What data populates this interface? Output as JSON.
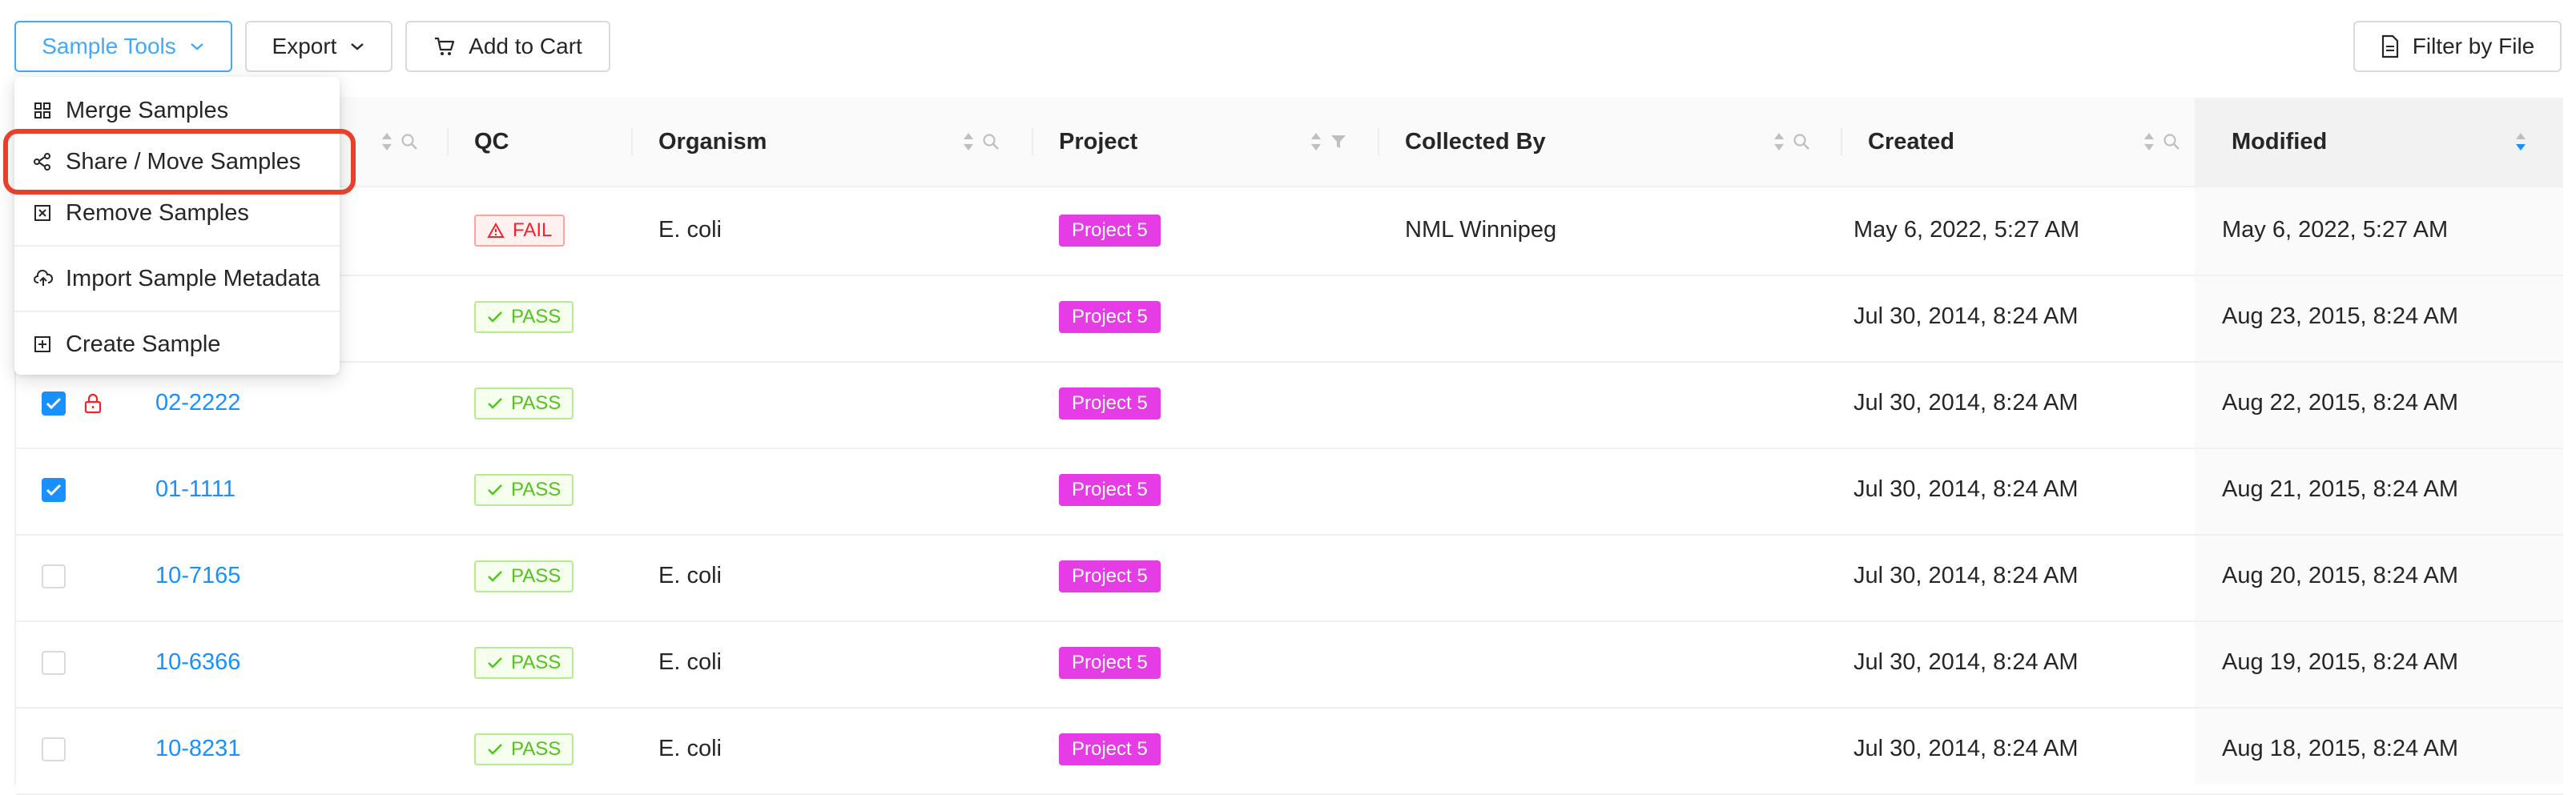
{
  "toolbar": {
    "sample_tools_label": "Sample Tools",
    "export_label": "Export",
    "add_to_cart_label": "Add to Cart",
    "filter_by_file_label": "Filter by File"
  },
  "table": {
    "columns": {
      "qc": "QC",
      "organism": "Organism",
      "project": "Project",
      "collected_by": "Collected By",
      "created": "Created",
      "modified": "Modified"
    },
    "sort": {
      "column": "Modified",
      "direction": "descending"
    },
    "rows": [
      {
        "selected": false,
        "locked": false,
        "name": "",
        "qc": "FAIL",
        "organism": "E. coli",
        "project": "Project 5",
        "collected_by": "NML Winnipeg",
        "created": "May 6, 2022, 5:27 AM",
        "modified": "May 6, 2022, 5:27 AM"
      },
      {
        "selected": false,
        "locked": false,
        "name": "",
        "qc": "PASS",
        "organism": "",
        "project": "Project 5",
        "collected_by": "",
        "created": "Jul 30, 2014, 8:24 AM",
        "modified": "Aug 23, 2015, 8:24 AM"
      },
      {
        "selected": true,
        "locked": true,
        "name": "02-2222",
        "qc": "PASS",
        "organism": "",
        "project": "Project 5",
        "collected_by": "",
        "created": "Jul 30, 2014, 8:24 AM",
        "modified": "Aug 22, 2015, 8:24 AM"
      },
      {
        "selected": true,
        "locked": false,
        "name": "01-1111",
        "qc": "PASS",
        "organism": "",
        "project": "Project 5",
        "collected_by": "",
        "created": "Jul 30, 2014, 8:24 AM",
        "modified": "Aug 21, 2015, 8:24 AM"
      },
      {
        "selected": false,
        "locked": false,
        "name": "10-7165",
        "qc": "PASS",
        "organism": "E. coli",
        "project": "Project 5",
        "collected_by": "",
        "created": "Jul 30, 2014, 8:24 AM",
        "modified": "Aug 20, 2015, 8:24 AM"
      },
      {
        "selected": false,
        "locked": false,
        "name": "10-6366",
        "qc": "PASS",
        "organism": "E. coli",
        "project": "Project 5",
        "collected_by": "",
        "created": "Jul 30, 2014, 8:24 AM",
        "modified": "Aug 19, 2015, 8:24 AM"
      },
      {
        "selected": false,
        "locked": false,
        "name": "10-8231",
        "qc": "PASS",
        "organism": "E. coli",
        "project": "Project 5",
        "collected_by": "",
        "created": "Jul 30, 2014, 8:24 AM",
        "modified": "Aug 18, 2015, 8:24 AM"
      }
    ]
  },
  "menu": {
    "items": [
      {
        "label": "Merge Samples",
        "icon": "merge-icon"
      },
      {
        "label": "Share / Move Samples",
        "icon": "share-icon",
        "highlighted": true
      },
      {
        "label": "Remove Samples",
        "icon": "remove-icon"
      },
      {
        "label": "Import Sample Metadata",
        "icon": "cloud-upload-icon"
      },
      {
        "label": "Create Sample",
        "icon": "plus-square-icon"
      }
    ]
  },
  "colors": {
    "accent": "#1890ff",
    "project_tag": "#e63ce6",
    "pass": "#52c41a",
    "fail": "#f5222d",
    "highlight_outline": "#e8412b"
  }
}
